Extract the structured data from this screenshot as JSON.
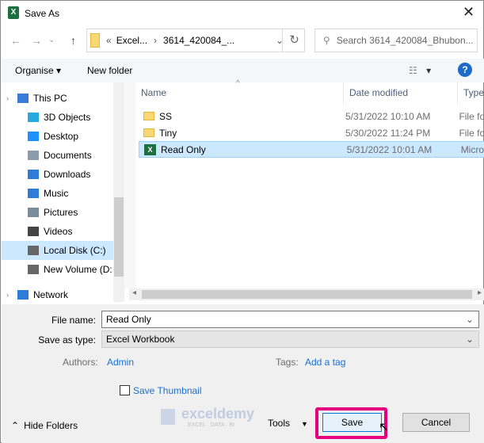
{
  "window": {
    "title": "Save As",
    "close": "✕"
  },
  "nav": {
    "back": "←",
    "forward": "→",
    "recent": "⌄",
    "up": "↑"
  },
  "address": {
    "overflow": "«",
    "crumbs": [
      "Excel...",
      "3614_420084_..."
    ],
    "sep": "›",
    "refresh": "↻"
  },
  "search": {
    "placeholder": "Search 3614_420084_Bhubon..."
  },
  "toolbar": {
    "organise": "Organise ▾",
    "new_folder": "New folder",
    "view": "▾",
    "help": "?"
  },
  "sidebar": {
    "items": [
      {
        "label": "This PC",
        "icon": "pc-icon",
        "color": "#3a7bd5"
      },
      {
        "label": "3D Objects",
        "icon": "cube-icon",
        "color": "#29a8e0"
      },
      {
        "label": "Desktop",
        "icon": "desktop-icon",
        "color": "#1e90ff"
      },
      {
        "label": "Documents",
        "icon": "documents-icon",
        "color": "#8c9bab"
      },
      {
        "label": "Downloads",
        "icon": "downloads-icon",
        "color": "#2f7bd8"
      },
      {
        "label": "Music",
        "icon": "music-icon",
        "color": "#2f7bd8"
      },
      {
        "label": "Pictures",
        "icon": "pictures-icon",
        "color": "#7a8d9f"
      },
      {
        "label": "Videos",
        "icon": "videos-icon",
        "color": "#444"
      },
      {
        "label": "Local Disk (C:)",
        "icon": "drive-icon",
        "color": "#666",
        "selected": true
      },
      {
        "label": "New Volume (D:",
        "icon": "drive-icon",
        "color": "#666"
      },
      {
        "label": "Network",
        "icon": "network-icon",
        "color": "#2f7bd8"
      }
    ]
  },
  "columns": [
    "Name",
    "Date modified",
    "Type"
  ],
  "files": [
    {
      "name": "SS",
      "date": "5/31/2022 10:10 AM",
      "type": "File fo",
      "icon": "folder-icon"
    },
    {
      "name": "Tiny",
      "date": "5/30/2022 11:24 PM",
      "type": "File fo",
      "icon": "folder-icon"
    },
    {
      "name": "Read Only",
      "date": "5/31/2022 10:01 AM",
      "type": "Micro",
      "icon": "excel-icon",
      "selected": true
    }
  ],
  "form": {
    "file_name_label": "File name:",
    "file_name": "Read Only",
    "type_label": "Save as type:",
    "type": "Excel Workbook",
    "authors_label": "Authors:",
    "authors": "Admin",
    "tags_label": "Tags:",
    "tags": "Add a tag",
    "thumbnail": "Save Thumbnail"
  },
  "footer": {
    "hide_folders": "Hide Folders",
    "tools": "Tools",
    "save": "Save",
    "cancel": "Cancel"
  },
  "watermark": {
    "brand": "exceldemy",
    "tagline": "EXCEL · DATA · BI"
  },
  "colors": {
    "highlight": "#e6007e",
    "selection": "#cce8ff",
    "link": "#1a6fce"
  }
}
